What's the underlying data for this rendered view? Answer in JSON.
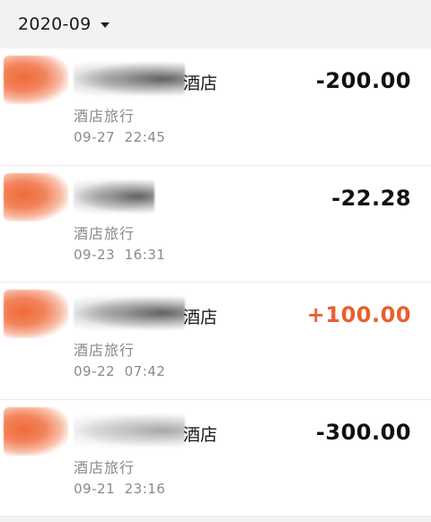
{
  "header": {
    "month": "2020-09",
    "caret_icon": "caret-down-icon"
  },
  "transactions": [
    {
      "name_suffix": "酒店",
      "category": "酒店旅行",
      "datetime": "09-27  22:45",
      "amount": "-200.00",
      "type": "expense"
    },
    {
      "name_suffix": "",
      "category": "酒店旅行",
      "datetime": "09-23  16:31",
      "amount": "-22.28",
      "type": "expense"
    },
    {
      "name_suffix": "酒店",
      "category": "酒店旅行",
      "datetime": "09-22  07:42",
      "amount": "+100.00",
      "type": "income"
    },
    {
      "name_suffix": "酒店",
      "category": "酒店旅行",
      "datetime": "09-21  23:16",
      "amount": "-300.00",
      "type": "expense"
    }
  ],
  "colors": {
    "income": "#e85f2f",
    "expense": "#111111",
    "header_bg": "#f2f2f4",
    "secondary_text": "#8a8a8a"
  }
}
